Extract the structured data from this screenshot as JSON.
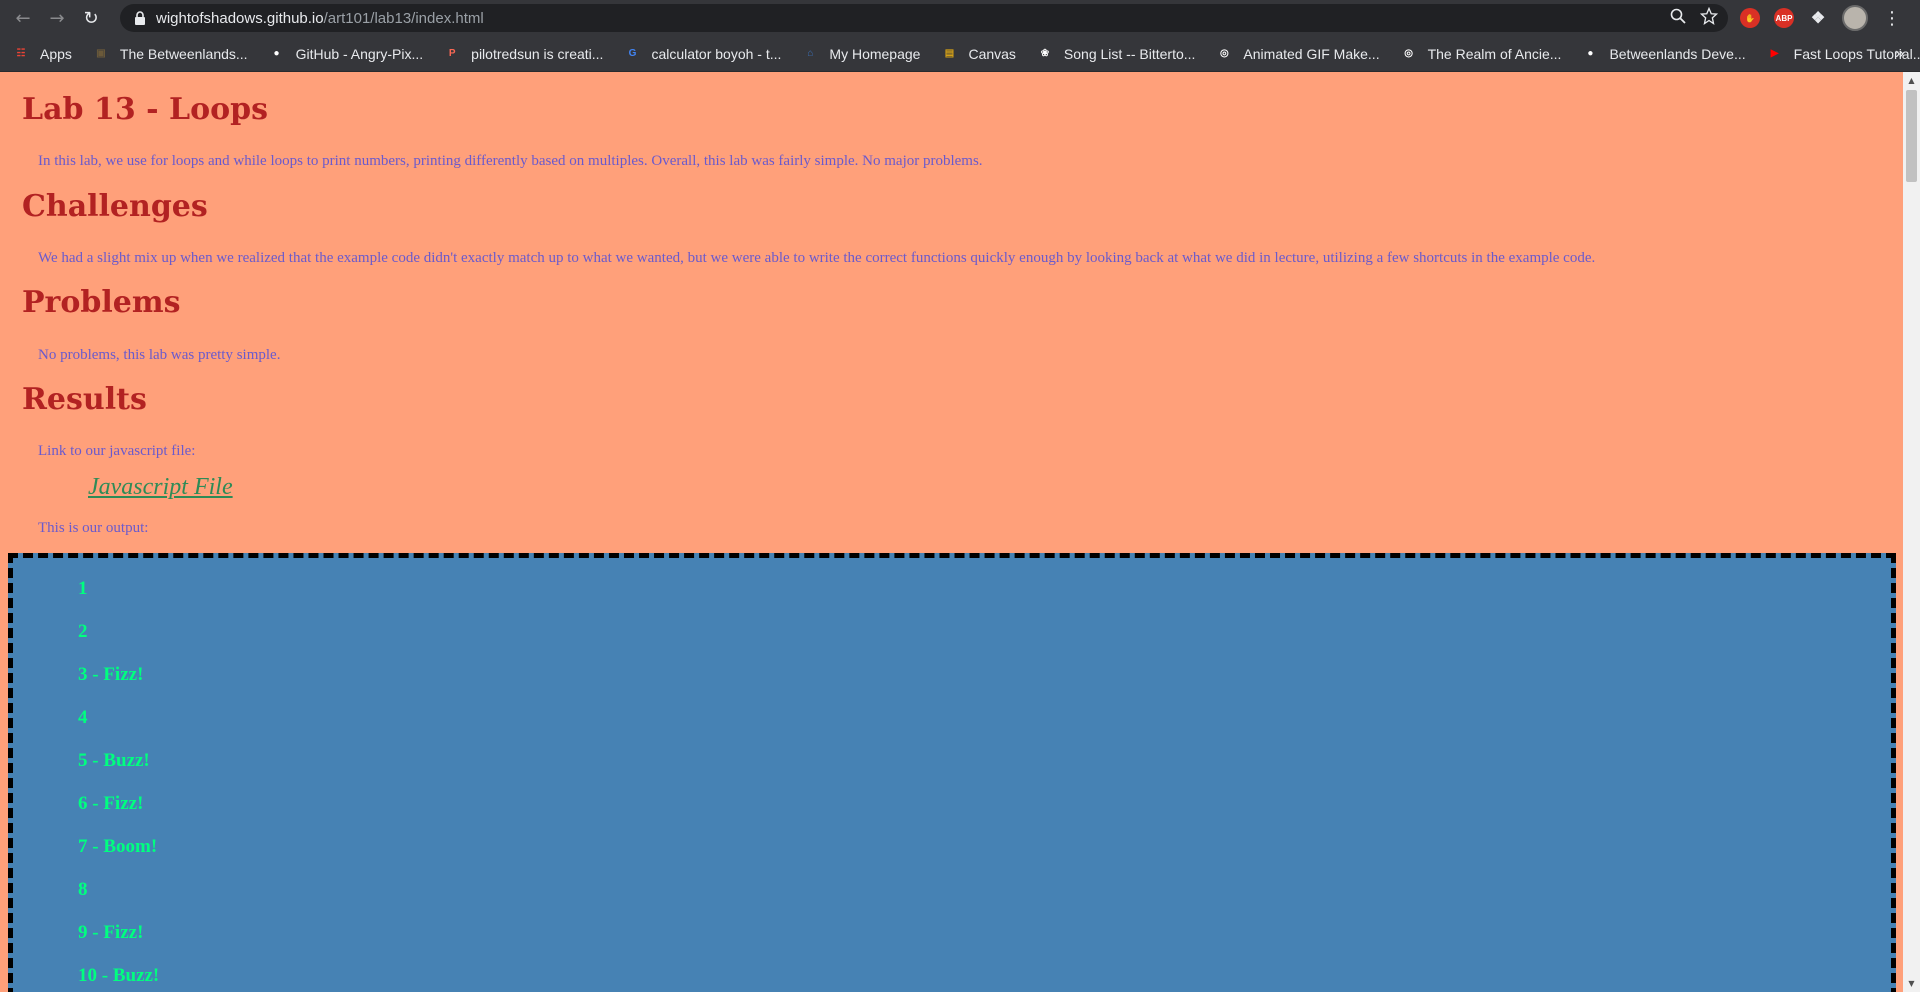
{
  "browser": {
    "url_host": "wightofshadows.github.io",
    "url_path": "/art101/lab13/index.html",
    "bookmarks": [
      {
        "label": "Apps",
        "icon": "apps-grid-icon",
        "color": "#ea4335"
      },
      {
        "label": "The Betweenlands...",
        "icon": "betweenlands-icon",
        "color": "#6b5a3a"
      },
      {
        "label": "GitHub - Angry-Pix...",
        "icon": "github-icon",
        "color": "#ffffff"
      },
      {
        "label": "pilotredsun is creati...",
        "icon": "patreon-icon",
        "color": "#f96854"
      },
      {
        "label": "calculator boyoh - t...",
        "icon": "google-icon",
        "color": "#4285f4"
      },
      {
        "label": "My Homepage",
        "icon": "homepage-icon",
        "color": "#3b6fb6"
      },
      {
        "label": "Canvas",
        "icon": "canvas-icon",
        "color": "#d4a017"
      },
      {
        "label": "Song List -- Bitterto...",
        "icon": "paw-icon",
        "color": "#ffffff"
      },
      {
        "label": "Animated GIF Make...",
        "icon": "globe-icon",
        "color": "#ffffff"
      },
      {
        "label": "The Realm of Ancie...",
        "icon": "globe-icon",
        "color": "#ffffff"
      },
      {
        "label": "Betweenlands Deve...",
        "icon": "github-icon",
        "color": "#ffffff"
      },
      {
        "label": "Fast Loops Tutorial...",
        "icon": "youtube-icon",
        "color": "#ff0000"
      }
    ],
    "extension_abp": "ABP",
    "more_bookmarks": "»"
  },
  "page": {
    "title": "Lab 13 - Loops",
    "intro": "In this lab, we use for loops and while loops to print numbers, printing differently based on multiples. Overall, this lab was fairly simple. No major problems.",
    "challenges_heading": "Challenges",
    "challenges_text": "We had a slight mix up when we realized that the example code didn't exactly match up to what we wanted, but we were able to write the correct functions quickly enough by looking back at what we did in lecture, utilizing a few shortcuts in the example code.",
    "problems_heading": "Problems",
    "problems_text": "No problems, this lab was pretty simple.",
    "results_heading": "Results",
    "link_intro": "Link to our javascript file:",
    "link_label": "Javascript File",
    "output_intro": "This is our output:",
    "output_lines": [
      "1",
      "2",
      "3 - Fizz!",
      "4",
      "5 - Buzz!",
      "6 - Fizz!",
      "7 - Boom!",
      "8",
      "9 - Fizz!",
      "10 - Buzz!"
    ]
  },
  "colors": {
    "page_background": "#ffa07a",
    "heading": "#b22222",
    "body_text": "#6a5acd",
    "link": "#2e8b57",
    "output_background": "#4682b4",
    "output_text": "#00ff7f"
  }
}
